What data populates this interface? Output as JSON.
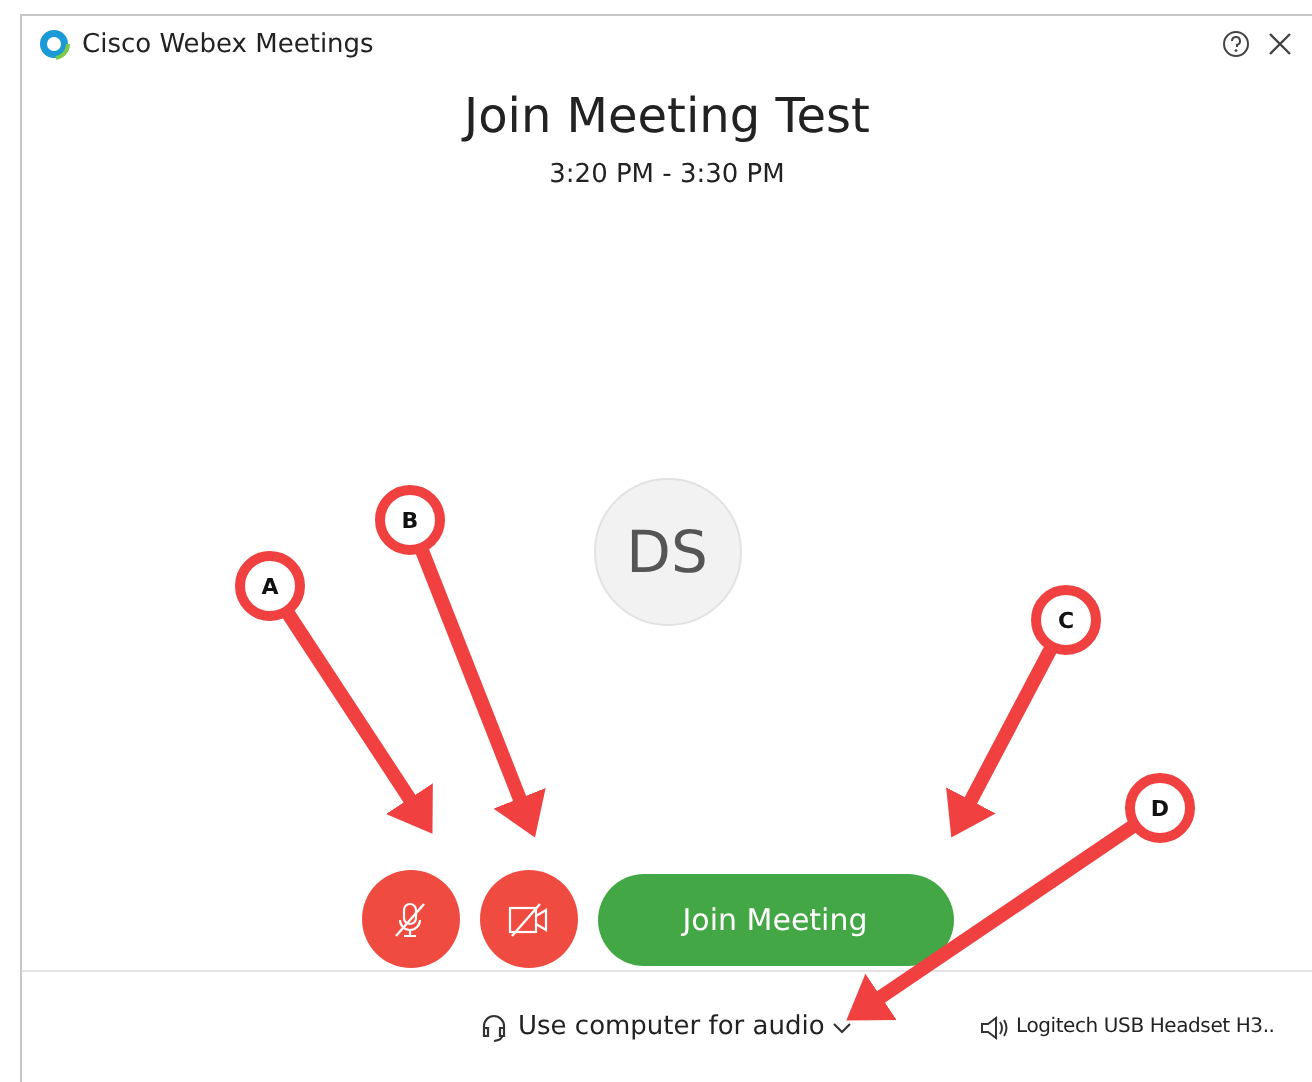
{
  "window": {
    "title": "Cisco Webex Meetings"
  },
  "meeting": {
    "title": "Join Meeting Test",
    "time": "3:20 PM - 3:30 PM",
    "avatar_initials": "DS"
  },
  "controls": {
    "mic_muted": true,
    "video_off": true,
    "join_button": "Join Meeting"
  },
  "audio": {
    "option": "Use computer for audio",
    "speaker": "Logitech USB Headset H3.."
  },
  "callouts": [
    {
      "label": "A"
    },
    {
      "label": "B"
    },
    {
      "label": "C"
    },
    {
      "label": "D"
    }
  ]
}
